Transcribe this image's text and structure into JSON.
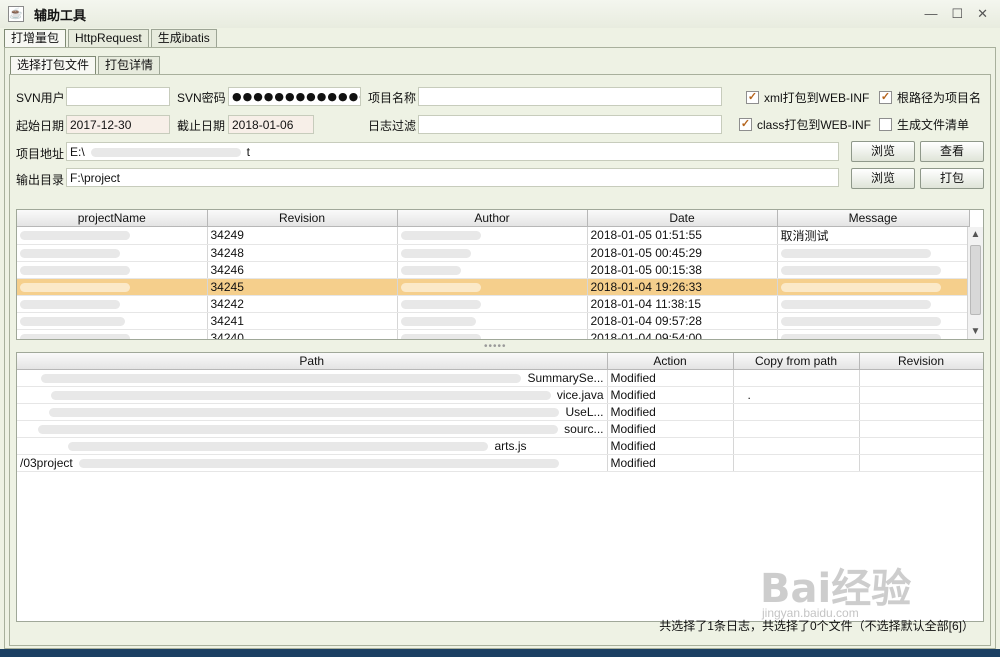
{
  "window": {
    "title": "辅助工具",
    "minimize": "—",
    "maximize": "☐",
    "close": "✕"
  },
  "tabs_main": [
    {
      "label": "打增量包"
    },
    {
      "label": "HttpRequest"
    },
    {
      "label": "生成ibatis"
    }
  ],
  "tabs_sub": [
    {
      "label": "选择打包文件"
    },
    {
      "label": "打包详情"
    }
  ],
  "form": {
    "svn_user_label": "SVN用户",
    "svn_user_value": "",
    "svn_pass_label": "SVN密码",
    "svn_pass_value": "●●●●●●●●●●●●●●●●●",
    "project_name_label": "项目名称",
    "project_name_value": "",
    "start_date_label": "起始日期",
    "start_date_value": "2017-12-30",
    "end_date_label": "截止日期",
    "end_date_value": "2018-01-06",
    "log_filter_label": "日志过滤",
    "log_filter_value": "",
    "project_path_label": "项目地址",
    "project_path_value": "E:\\",
    "project_path_suffix": "t",
    "output_dir_label": "输出目录",
    "output_dir_value": "F:\\project"
  },
  "checkboxes": [
    {
      "label": "xml打包到WEB-INF",
      "checked": true
    },
    {
      "label": "根路径为项目名",
      "checked": true
    },
    {
      "label": "class打包到WEB-INF",
      "checked": true
    },
    {
      "label": "生成文件清单",
      "checked": false
    }
  ],
  "buttons": {
    "browse1": "浏览",
    "view": "查看",
    "browse2": "浏览",
    "package": "打包"
  },
  "log_table": {
    "columns": [
      "projectName",
      "Revision",
      "Author",
      "Date",
      "Message"
    ],
    "rows": [
      {
        "project": "",
        "revision": "34249",
        "author": "",
        "date": "2018-01-05 01:51:55",
        "message": "取消测试",
        "selected": false
      },
      {
        "project": "",
        "revision": "34248",
        "author": "",
        "date": "2018-01-05 00:45:29",
        "message": "",
        "selected": false
      },
      {
        "project": "",
        "revision": "34246",
        "author": "",
        "date": "2018-01-05 00:15:38",
        "message": "",
        "selected": false
      },
      {
        "project": "",
        "revision": "34245",
        "author": "",
        "date": "2018-01-04 19:26:33",
        "message": "",
        "selected": true
      },
      {
        "project": "",
        "revision": "34242",
        "author": "",
        "date": "2018-01-04 11:38:15",
        "message": "",
        "selected": false
      },
      {
        "project": "",
        "revision": "34241",
        "author": "",
        "date": "2018-01-04 09:57:28",
        "message": "",
        "selected": false
      },
      {
        "project": "",
        "revision": "34240",
        "author": "",
        "date": "2018-01-04 09:54:00",
        "message": "",
        "selected": false
      }
    ]
  },
  "path_table": {
    "columns": [
      "Path",
      "Action",
      "Copy from path",
      "Revision"
    ],
    "rows": [
      {
        "path": "SummarySe...",
        "action": "Modified",
        "copy_from": "",
        "revision": ""
      },
      {
        "path": "vice.java",
        "action": "Modified",
        "copy_from": ".",
        "revision": ""
      },
      {
        "path": "UseL...",
        "action": "Modified",
        "copy_from": "",
        "revision": ""
      },
      {
        "path": "sourc...",
        "action": "Modified",
        "copy_from": "",
        "revision": ""
      },
      {
        "path": "arts.js",
        "action": "Modified",
        "copy_from": "",
        "revision": ""
      },
      {
        "path": "/03project",
        "action": "Modified",
        "copy_from": "",
        "revision": ""
      }
    ]
  },
  "status": "共选择了1条日志，共选择了0个文件（不选择默认全部[6]）",
  "divider": "•••••",
  "watermark": {
    "brand": "Bai经验",
    "url": "jingyan.baidu.com"
  },
  "colors": {
    "selected_row": "#f5cf8c",
    "window_bg": "#eef2e4",
    "checkbox_mark": "#b5651d"
  }
}
